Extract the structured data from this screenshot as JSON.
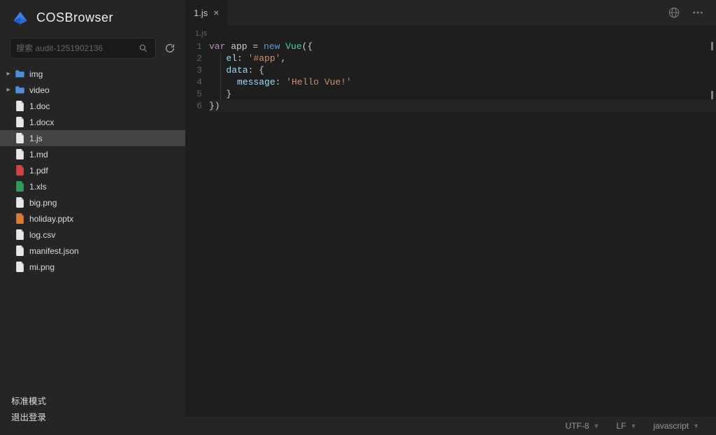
{
  "app": {
    "title": "COSBrowser"
  },
  "search": {
    "placeholder": "搜索 audit-1251902136"
  },
  "tree": {
    "folders": [
      {
        "label": "img"
      },
      {
        "label": "video"
      }
    ],
    "files": [
      {
        "label": "1.doc",
        "type": "doc"
      },
      {
        "label": "1.docx",
        "type": "doc"
      },
      {
        "label": "1.js",
        "type": "file",
        "selected": true
      },
      {
        "label": "1.md",
        "type": "file"
      },
      {
        "label": "1.pdf",
        "type": "pdf"
      },
      {
        "label": "1.xls",
        "type": "xls"
      },
      {
        "label": "big.png",
        "type": "file"
      },
      {
        "label": "holiday.pptx",
        "type": "ppt"
      },
      {
        "label": "log.csv",
        "type": "file"
      },
      {
        "label": "manifest.json",
        "type": "file"
      },
      {
        "label": "mi.png",
        "type": "file"
      }
    ]
  },
  "footer": {
    "mode": "标准模式",
    "logout": "退出登录"
  },
  "tab": {
    "label": "1.js",
    "breadcrumb": "1.js"
  },
  "code": {
    "line_numbers": [
      "1",
      "2",
      "3",
      "4",
      "5",
      "6"
    ],
    "l1_var": "var",
    "l1_app": " app ",
    "l1_eq": "= ",
    "l1_new": "new",
    "l1_vue": " Vue",
    "l1_paren": "({",
    "l2_el": "el",
    "l2_colon": ": ",
    "l2_str": "'#app'",
    "l2_comma": ",",
    "l3_data": "data",
    "l3_colon": ": {",
    "l4_msg": "message",
    "l4_colon": ": ",
    "l4_str": "'Hello Vue!'",
    "l5_close": "}",
    "l6_close": "})"
  },
  "status": {
    "encoding": "UTF-8",
    "eol": "LF",
    "lang": "javascript"
  },
  "colors": {
    "folder": "#4a8fd8",
    "file_default": "#e8e8e8",
    "pdf": "#d14545",
    "xls": "#2e9e5b",
    "ppt": "#d97a2e"
  }
}
